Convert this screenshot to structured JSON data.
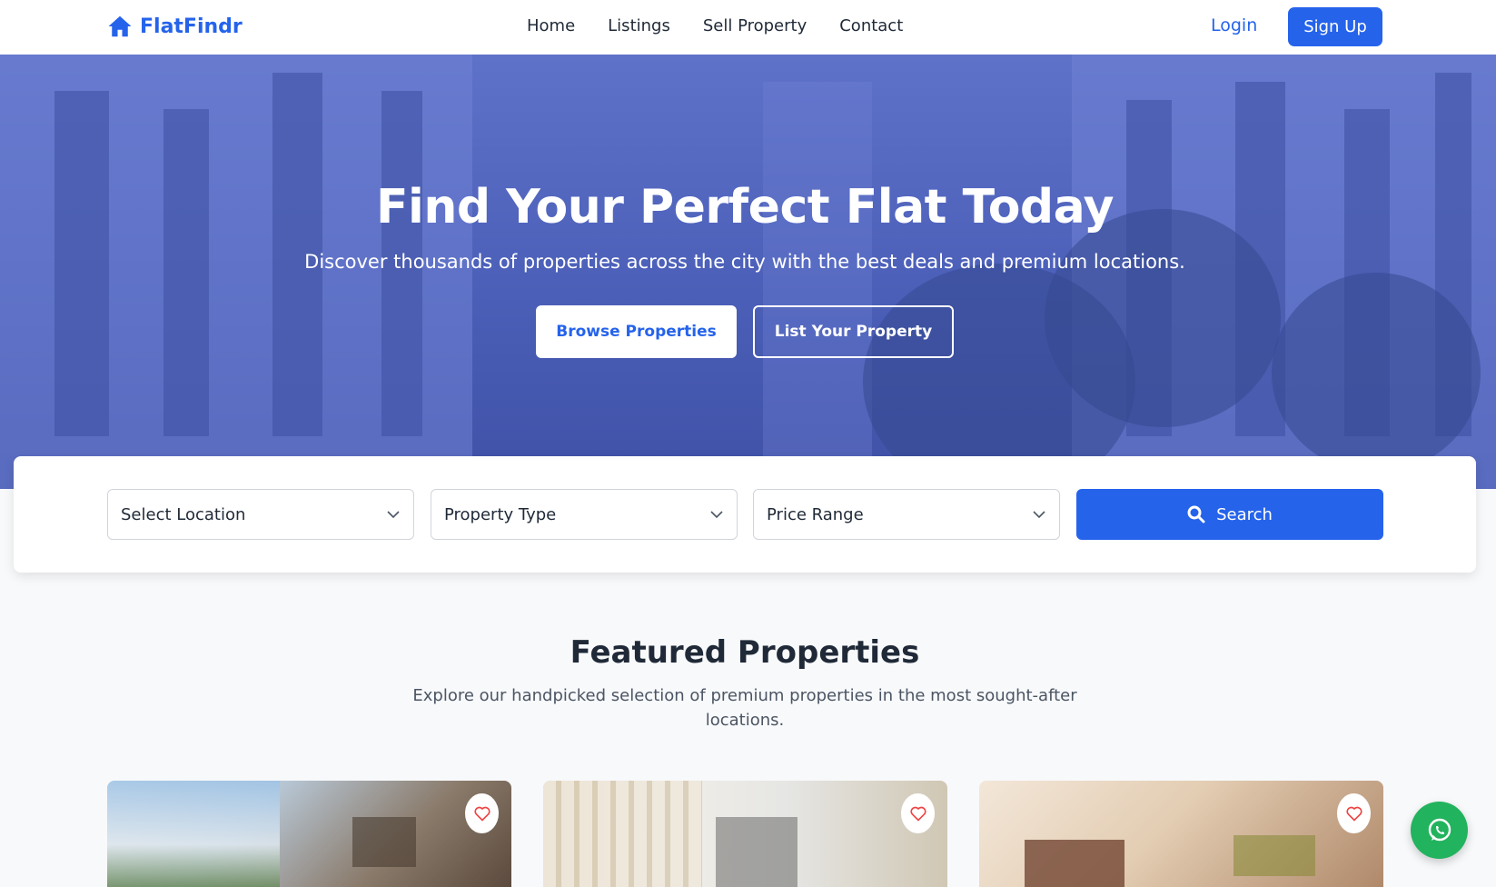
{
  "brand": {
    "name": "FlatFindr",
    "color": "#2563eb"
  },
  "nav": {
    "links": [
      "Home",
      "Listings",
      "Sell Property",
      "Contact"
    ],
    "login": "Login",
    "signup": "Sign Up"
  },
  "hero": {
    "title": "Find Your Perfect Flat Today",
    "subtitle": "Discover thousands of properties across the city with the best deals and premium locations.",
    "browse_button": "Browse Properties",
    "list_button": "List Your Property"
  },
  "search": {
    "location": "Select Location",
    "type": "Property Type",
    "price": "Price Range",
    "button": "Search"
  },
  "featured": {
    "title": "Featured Properties",
    "subtitle": "Explore our handpicked selection of premium properties in the most sought-after locations."
  },
  "icons": {
    "brand": "house-icon",
    "favorite": "heart-icon",
    "search": "search-icon",
    "chat": "whatsapp-icon"
  }
}
